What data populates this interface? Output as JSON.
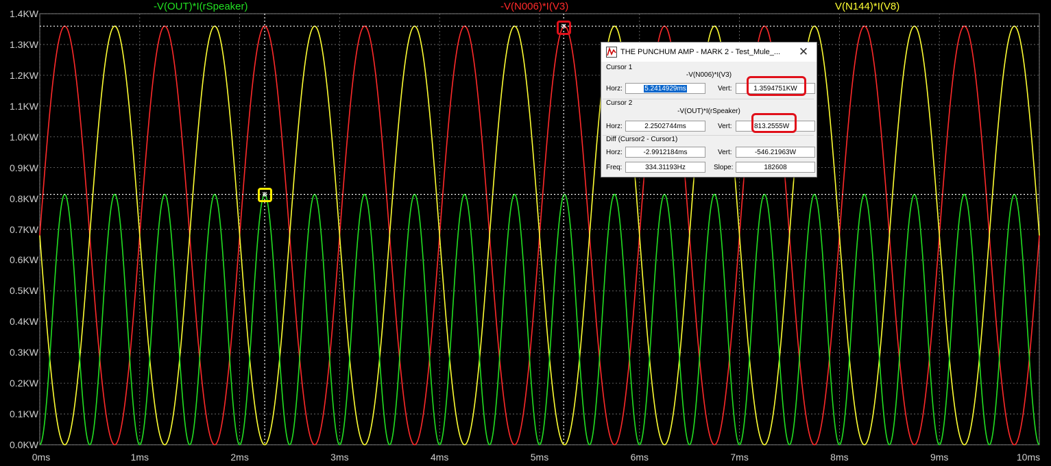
{
  "window": {
    "title": "THE PUNCHUM AMP - MARK 2 -  Test_Mule_...",
    "close_glyph": "✕",
    "icon": "ltspice-waveform-icon"
  },
  "traces": [
    {
      "label": "-V(OUT)*I(rSpeaker)",
      "color": "#22e022"
    },
    {
      "label": "-V(N006)*I(V3)",
      "color": "#ff2a2a"
    },
    {
      "label": "V(N144)*I(V8)",
      "color": "#ffff33"
    }
  ],
  "axes": {
    "y_ticks": [
      "0.0KW",
      "0.1KW",
      "0.2KW",
      "0.3KW",
      "0.4KW",
      "0.5KW",
      "0.6KW",
      "0.7KW",
      "0.8KW",
      "0.9KW",
      "1.0KW",
      "1.1KW",
      "1.2KW",
      "1.3KW",
      "1.4KW"
    ],
    "x_ticks": [
      "0ms",
      "1ms",
      "2ms",
      "3ms",
      "4ms",
      "5ms",
      "6ms",
      "7ms",
      "8ms",
      "9ms",
      "10ms"
    ],
    "grid_color": "#7a7a7a"
  },
  "chart_data": {
    "type": "line",
    "x_unit": "ms",
    "y_unit": "KW",
    "xlim": [
      0,
      10
    ],
    "ylim": [
      0,
      1.4
    ],
    "grid": true,
    "series": [
      {
        "name": "-V(N006)*I(V3)",
        "shape": "sin^2",
        "peak_kw": 1.3595,
        "period_ms": 1.0,
        "first_peak_ms": 0.25
      },
      {
        "name": "V(N144)*I(V8)",
        "shape": "sin^2",
        "peak_kw": 1.3595,
        "period_ms": 1.0,
        "first_peak_ms": 0.75
      },
      {
        "name": "-V(OUT)*I(rSpeaker)",
        "shape": "sin^2",
        "peak_kw": 0.8133,
        "period_ms": 0.5,
        "first_peak_ms": 0.25
      }
    ],
    "cursors": [
      {
        "name": "Cursor 1",
        "x_ms": 5.2415,
        "y_kw": 1.3595,
        "color": "#ff2a2a"
      },
      {
        "name": "Cursor 2",
        "x_ms": 2.2503,
        "y_kw": 0.8133,
        "color": "#ffff33"
      }
    ]
  },
  "dialog": {
    "cursor1": {
      "section": "Cursor 1",
      "trace": "-V(N006)*I(V3)",
      "horz_label": "Horz:",
      "horz": "5.2414929ms",
      "vert_label": "Vert:",
      "vert": "1.3594751KW"
    },
    "cursor2": {
      "section": "Cursor 2",
      "trace": "-V(OUT)*I(rSpeaker)",
      "horz_label": "Horz:",
      "horz": "2.2502744ms",
      "vert_label": "Vert:",
      "vert": "813.2555W"
    },
    "diff": {
      "section": "Diff (Cursor2 - Cursor1)",
      "horz_label": "Horz:",
      "horz": "-2.9912184ms",
      "vert_label": "Vert:",
      "vert": "-546.21963W",
      "freq_label": "Freq:",
      "freq": "334.31193Hz",
      "slope_label": "Slope:",
      "slope": "182608"
    }
  }
}
